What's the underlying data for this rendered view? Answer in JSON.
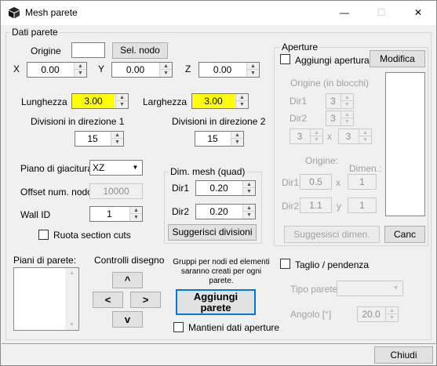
{
  "window": {
    "title": "Mesh parete",
    "minimize": "—",
    "maximize": "☐",
    "close": "✕"
  },
  "dati_parete": {
    "group_title": "Dati parete",
    "origine_label": "Origine",
    "origine_value": "",
    "sel_nodo": "Sel. nodo",
    "x_label": "X",
    "x_value": "0.00",
    "y_label": "Y",
    "y_value": "0.00",
    "z_label": "Z",
    "z_value": "0.00",
    "lunghezza_label": "Lunghezza",
    "lunghezza_value": "3.00",
    "larghezza_label": "Larghezza",
    "larghezza_value": "3.00",
    "div1_label": "Divisioni in direzione 1",
    "div1_value": "15",
    "div2_label": "Divisioni in direzione 2",
    "div2_value": "15",
    "piano_label": "Piano di giacitura",
    "piano_value": "XZ",
    "offset_label": "Offset num. nodo",
    "offset_value": "10000",
    "wallid_label": "Wall ID",
    "wallid_value": "1",
    "ruota_label": "Ruota section cuts",
    "dim_mesh": {
      "title": "Dim. mesh (quad)",
      "dir1_label": "Dir1",
      "dir1_value": "0.20",
      "dir2_label": "Dir2",
      "dir2_value": "0.20",
      "suggerisci": "Suggerisci divisioni"
    },
    "piani_label": "Piani di parete:",
    "controlli_label": "Controlli disegno",
    "ctrl_up": "^",
    "ctrl_left": "<",
    "ctrl_right": ">",
    "ctrl_down": "v",
    "gruppi_note_1": "Gruppi per nodi ed elementi",
    "gruppi_note_2": "saranno creati per ogni",
    "gruppi_note_3": "parete.",
    "aggiungi_1": "Aggiungi",
    "aggiungi_2": "parete",
    "mantieni_label": "Mantieni dati aperture"
  },
  "aperture": {
    "group_title": "Aperture",
    "aggiungi_apertura": "Aggiungi apertura",
    "modifica": "Modifica",
    "origine_blocchi": "Origine (in blocchi)",
    "dir1_label": "Dir1",
    "dir1_value": "3",
    "dir2_label": "Dir2",
    "dir2_value": "3",
    "grid_a": "3",
    "grid_x": "x",
    "grid_b": "3",
    "origine_label": "Origine:",
    "dimen_label": "Dimen.:",
    "o_dir1_label": "Dir1",
    "o_dir1_value": "0.5",
    "x_sep": "x",
    "d_dir1_value": "1",
    "o_dir2_label": "Dir2",
    "o_dir2_value": "1.1",
    "y_sep": "y",
    "d_dir2_value": "1",
    "suggerisci_dimen": "Suggesisci dimen.",
    "canc": "Canc"
  },
  "taglio": {
    "label": "Taglio / pendenza",
    "tipo_label": "Tipo parete",
    "tipo_value": "",
    "angolo_label": "Angolo [°]",
    "angolo_value": "20.0"
  },
  "footer": {
    "chiudi": "Chiudi"
  }
}
